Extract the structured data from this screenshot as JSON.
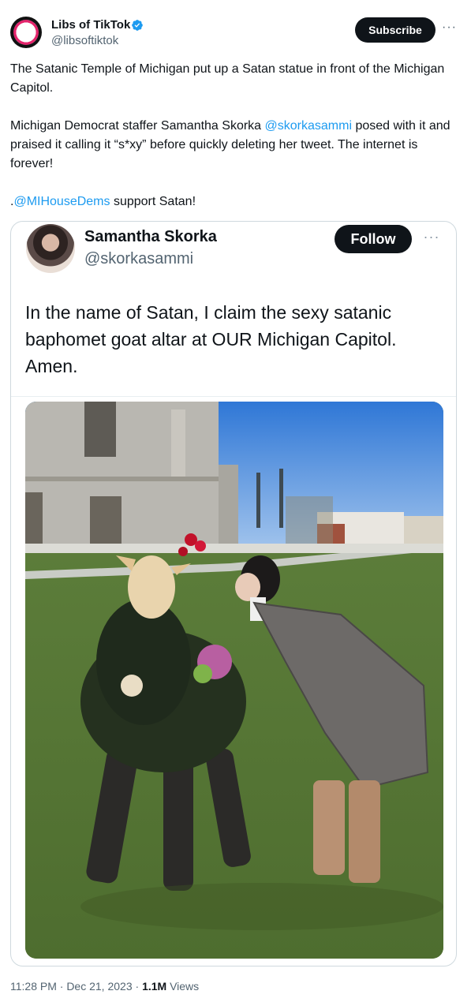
{
  "author": {
    "name": "Libs of TikTok",
    "handle": "@libsoftiktok",
    "avatar_text": "Libs of TikTok",
    "verified_icon": "verified-badge-icon"
  },
  "actions": {
    "subscribe_label": "Subscribe",
    "more_label": "···"
  },
  "tweet": {
    "line1": "The Satanic Temple of Michigan put up a Satan statue in front of the Michigan Capitol.",
    "line2_before": "Michigan Democrat staffer Samantha Skorka ",
    "line2_mention": "@skorkasammi",
    "line2_after": " posed with it and praised it calling it “s*xy” before quickly deleting her tweet. The internet is forever!",
    "line3_prefix": ".",
    "line3_mention": "@MIHouseDems",
    "line3_after": " support Satan!"
  },
  "quote": {
    "name": "Samantha Skorka",
    "handle": "@skorkasammi",
    "follow_label": "Follow",
    "more_label": "···",
    "text": "In the name of Satan, I claim the sexy satanic baphomet goat altar at OUR Michigan Capitol. Amen."
  },
  "meta": {
    "time": "11:28 PM · Dec 21, 2023 · ",
    "views_count": "1.1M",
    "views_label": " Views"
  },
  "colors": {
    "link": "#1d9bf0",
    "button_bg": "#0f1419",
    "secondary_text": "#536471"
  }
}
